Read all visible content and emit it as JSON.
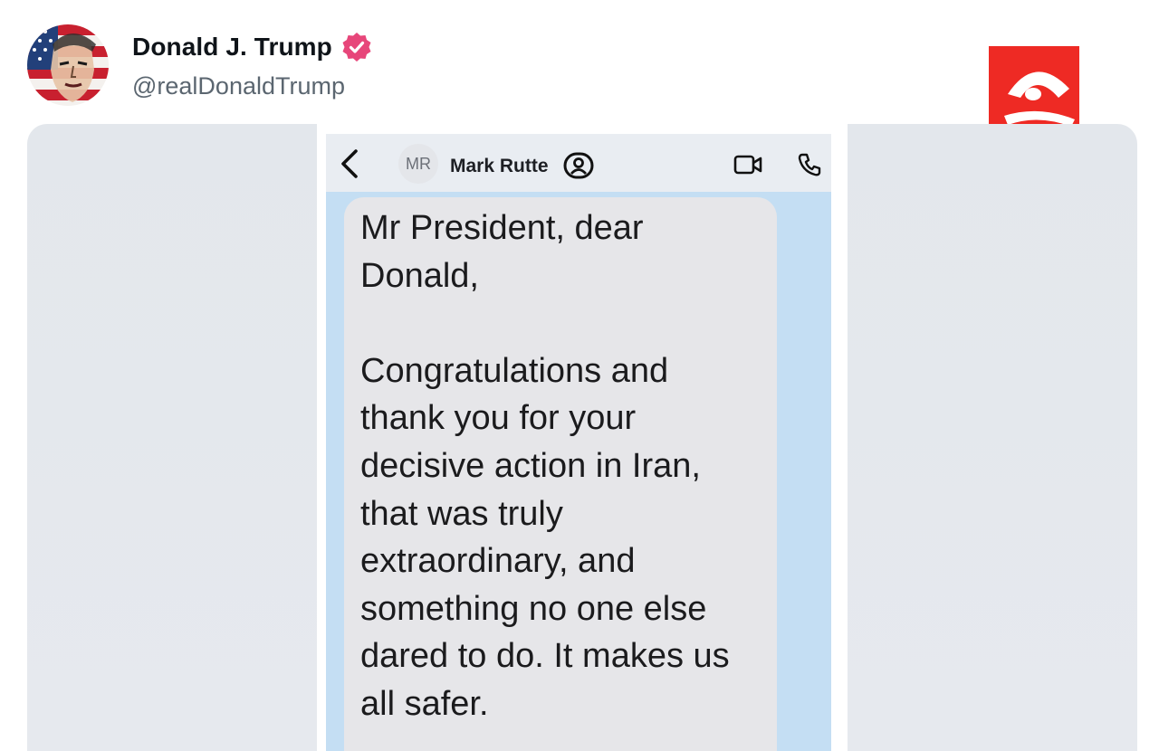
{
  "post": {
    "author": {
      "display_name": "Donald J. Trump",
      "handle": "@realDonaldTrump",
      "verified_icon": "verified-badge-icon",
      "badge_color": "#e7467a"
    }
  },
  "watermark": {
    "icon": "news-station-logo-icon",
    "color": "#ee2a24"
  },
  "screenshot": {
    "chat_header": {
      "back_icon": "chevron-left-icon",
      "contact_initials": "MR",
      "contact_name": "Mark Rutte",
      "contact_icon": "profile-icon",
      "video_icon": "video-camera-icon",
      "call_icon": "phone-icon"
    },
    "message": {
      "text": "Mr President, dear\nDonald,\n\nCongratulations and\nthank you for your\ndecisive action in Iran,\nthat was truly\nextraordinary, and\nsomething no one else\ndared to do.  It makes us\nall safer."
    }
  },
  "colors": {
    "name_text": "#0f1419",
    "handle_text": "#5b6670",
    "media_background": "#e4e8ed",
    "chat_background": "#c4def3",
    "bubble": "#e6e6e9"
  }
}
